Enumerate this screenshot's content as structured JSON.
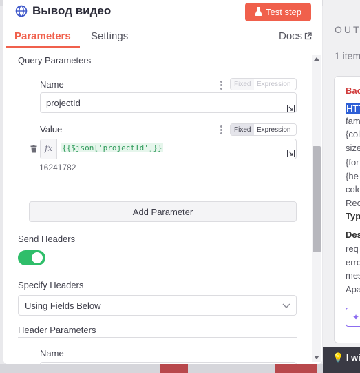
{
  "node": {
    "title": "Вывод видео",
    "test_button": "Test step"
  },
  "tabs": {
    "parameters": "Parameters",
    "settings": "Settings",
    "docs": "Docs"
  },
  "query_parameters": {
    "section_label": "Query Parameters",
    "name_label": "Name",
    "name_value": "projectId",
    "value_label": "Value",
    "value_expression": "{{$json['projectId']}}",
    "value_preview": "16241782",
    "mode_fixed": "Fixed",
    "mode_expression": "Expression",
    "add_button": "Add Parameter"
  },
  "send_headers": {
    "label": "Send Headers",
    "enabled": true
  },
  "specify_headers": {
    "label": "Specify Headers",
    "selected": "Using Fields Below"
  },
  "header_parameters": {
    "section_label": "Header Parameters",
    "name_label": "Name"
  },
  "output": {
    "title": "OUTPUT",
    "count": "1 item",
    "lines": [
      "Bac",
      "HTT",
      "fam",
      "{col",
      "size",
      "{for",
      "{he",
      "colo",
      "Rec",
      "Typ",
      "Des",
      "req",
      "erro",
      "mes",
      "Apa"
    ],
    "footer": "I wis"
  },
  "colors": {
    "accent": "#f0604c",
    "toggle_on": "#2fbe6a",
    "expression_green": "#2f9a5a"
  }
}
